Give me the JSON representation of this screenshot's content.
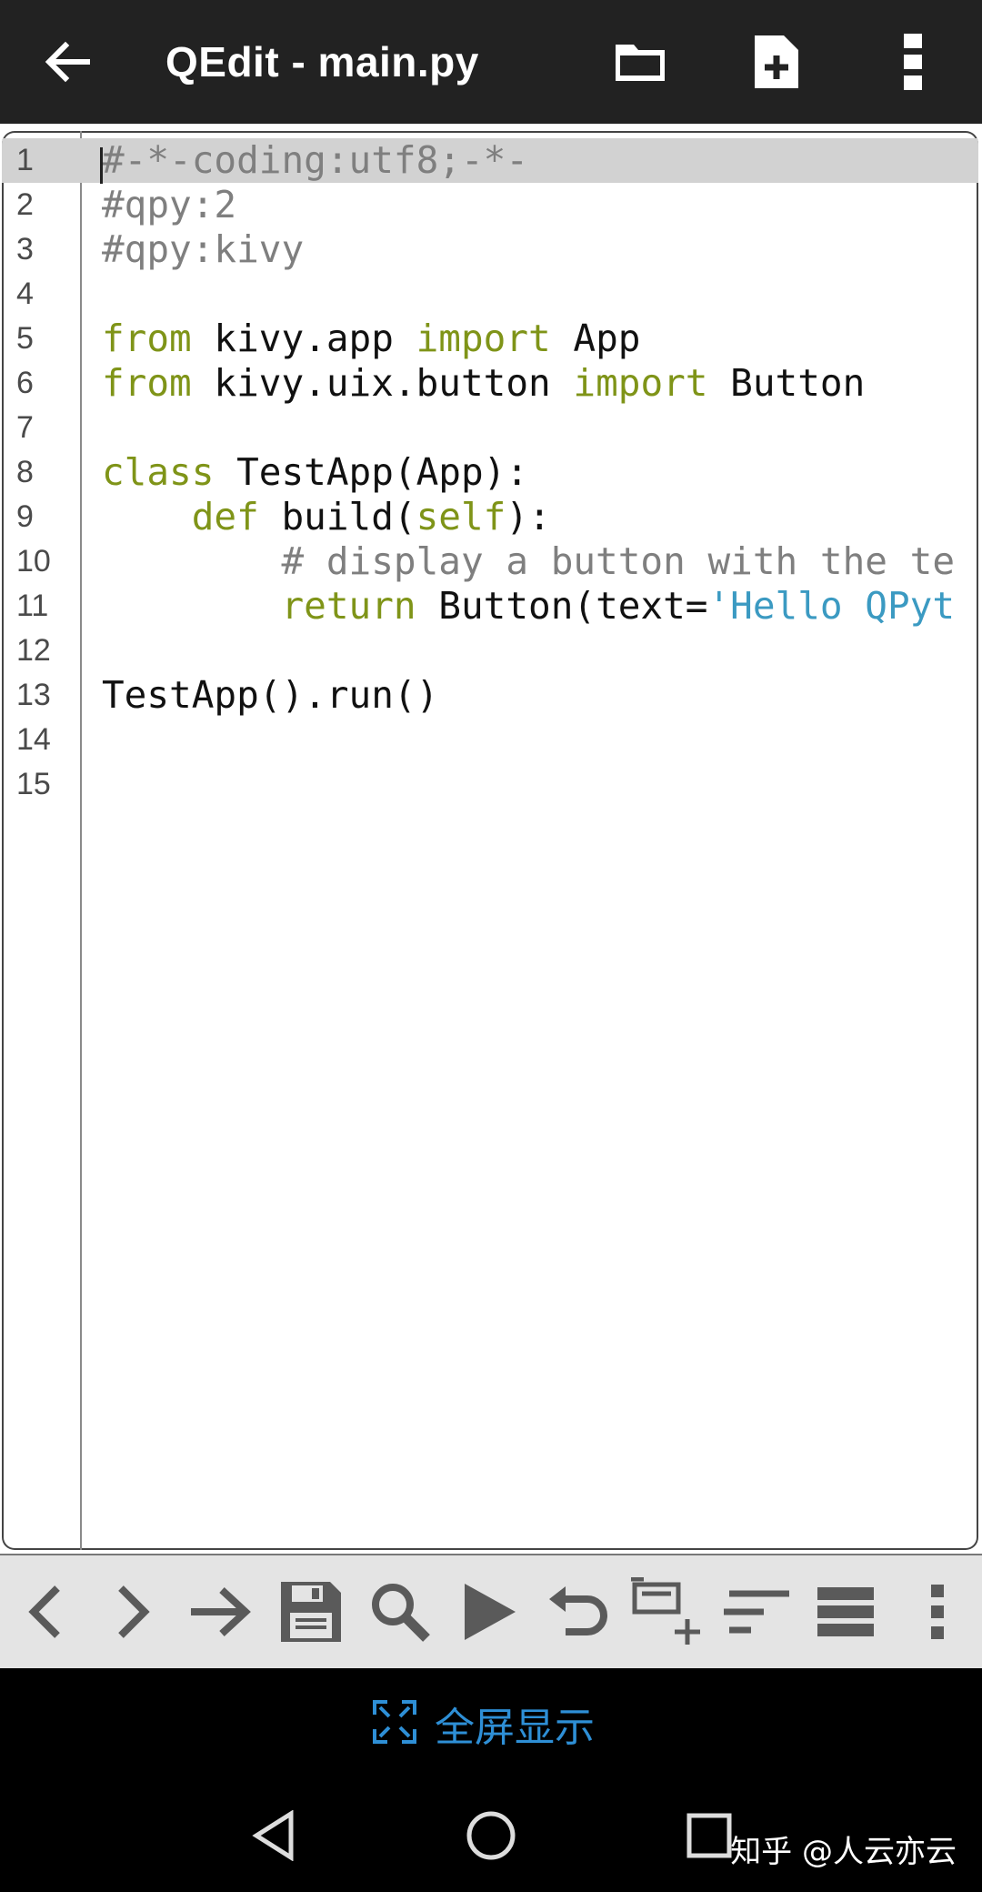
{
  "app": {
    "title": "QEdit - main.py",
    "icons": [
      "back-arrow-icon",
      "folder-icon",
      "new-file-icon",
      "more-vertical-icon"
    ]
  },
  "editor": {
    "current_line": 1,
    "lines": [
      {
        "n": "1",
        "tokens": [
          {
            "t": "#-*-coding:utf8;-*-",
            "c": "com"
          }
        ]
      },
      {
        "n": "2",
        "tokens": [
          {
            "t": "#qpy:2",
            "c": "com"
          }
        ]
      },
      {
        "n": "3",
        "tokens": [
          {
            "t": "#qpy:kivy",
            "c": "com"
          }
        ]
      },
      {
        "n": "4",
        "tokens": []
      },
      {
        "n": "5",
        "tokens": [
          {
            "t": "from",
            "c": "kw"
          },
          {
            "t": " kivy.app ",
            "c": "id"
          },
          {
            "t": "import",
            "c": "kw"
          },
          {
            "t": " App",
            "c": "id"
          }
        ]
      },
      {
        "n": "6",
        "tokens": [
          {
            "t": "from",
            "c": "kw"
          },
          {
            "t": " kivy.uix.button ",
            "c": "id"
          },
          {
            "t": "import",
            "c": "kw"
          },
          {
            "t": " Button",
            "c": "id"
          }
        ]
      },
      {
        "n": "7",
        "tokens": []
      },
      {
        "n": "8",
        "tokens": [
          {
            "t": "class",
            "c": "kw"
          },
          {
            "t": " TestApp(App):",
            "c": "id"
          }
        ]
      },
      {
        "n": "9",
        "tokens": [
          {
            "t": "    ",
            "c": "id"
          },
          {
            "t": "def",
            "c": "kw"
          },
          {
            "t": " build(",
            "c": "id"
          },
          {
            "t": "self",
            "c": "kw"
          },
          {
            "t": "):",
            "c": "id"
          }
        ]
      },
      {
        "n": "10",
        "tokens": [
          {
            "t": "        ",
            "c": "id"
          },
          {
            "t": "# display a button with the te",
            "c": "com"
          }
        ]
      },
      {
        "n": "11",
        "tokens": [
          {
            "t": "        ",
            "c": "id"
          },
          {
            "t": "return",
            "c": "kw"
          },
          {
            "t": " Button(text=",
            "c": "id"
          },
          {
            "t": "'Hello QPyt",
            "c": "str"
          }
        ]
      },
      {
        "n": "12",
        "tokens": []
      },
      {
        "n": "13",
        "tokens": [
          {
            "t": "TestApp().run()",
            "c": "id"
          }
        ]
      },
      {
        "n": "14",
        "tokens": []
      },
      {
        "n": "15",
        "tokens": []
      }
    ]
  },
  "toolbar": {
    "items": [
      "chevron-left-icon",
      "chevron-right-icon",
      "arrow-right-icon",
      "save-icon",
      "search-icon",
      "play-icon",
      "undo-icon",
      "add-snippet-icon",
      "indent-lines-icon",
      "format-lines-icon",
      "more-vertical-icon"
    ]
  },
  "fullscreen": {
    "label": "全屏显示",
    "icon": "fullscreen-icon"
  },
  "system_nav": {
    "icons": [
      "nav-back-icon",
      "nav-home-icon",
      "nav-recents-icon"
    ],
    "watermark": "知乎 @人云亦云"
  },
  "colors": {
    "appbar": "#222222",
    "comment": "#7f7f7f",
    "keyword": "#7f9418",
    "string": "#3b9ac2",
    "current_line": "#d2d2d2",
    "fullscreen_label": "#2e8fd6"
  }
}
